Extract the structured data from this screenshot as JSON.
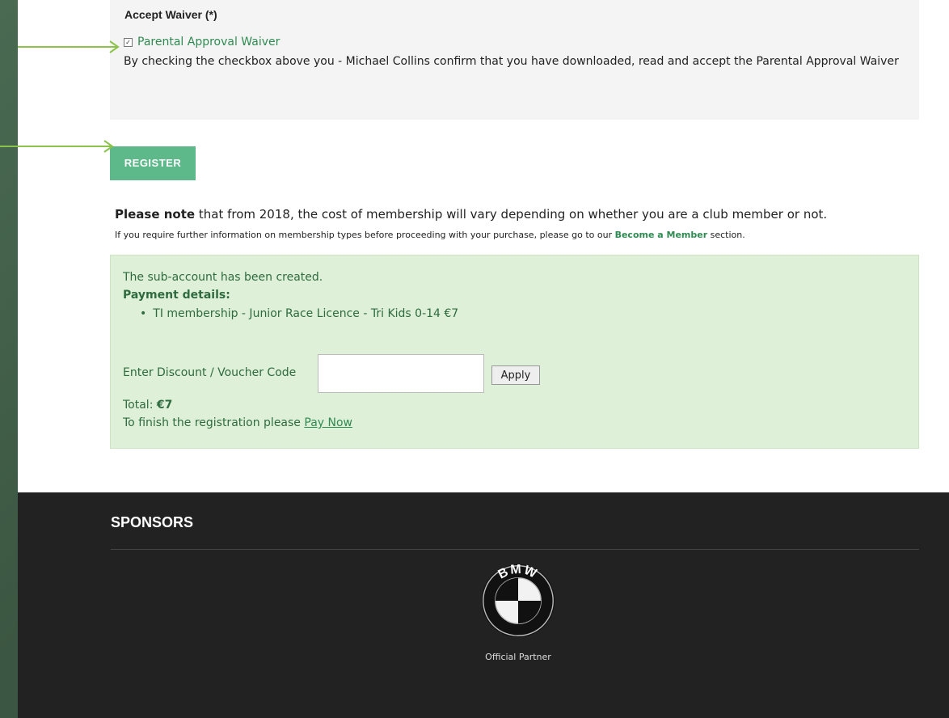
{
  "waiver": {
    "title": "Accept Waiver (*)",
    "checkbox_label": "Parental Approval Waiver",
    "checked": true,
    "description": "By checking the checkbox above you - Michael Collins confirm that you have downloaded, read and accept the Parental Approval Waiver"
  },
  "register": {
    "label": "REGISTER"
  },
  "note": {
    "bold": "Please note",
    "text": " that from 2018, the cost of membership will vary depending on whether you are a club member or not.",
    "small_prefix": "If you require further information on membership types before proceeding with your purchase, please go to our ",
    "small_link": "Become a Member",
    "small_suffix": " section."
  },
  "payment": {
    "created_msg": "The sub-account has been created.",
    "details_label": "Payment details:",
    "items": [
      "TI membership - Junior Race Licence - Tri Kids 0-14 €7"
    ],
    "discount_label": "Enter Discount / Voucher Code",
    "discount_value": "",
    "apply_label": "Apply",
    "total_label": "Total:",
    "total_value": "€7",
    "finish_prefix": "To finish the registration please ",
    "finish_link": "Pay Now"
  },
  "footer": {
    "sponsors_title": "SPONSORS",
    "sponsor_logo_text": "BMW",
    "partner_label": "Official Partner"
  },
  "colors": {
    "accent_green": "#2f8a52",
    "register_bg": "#5db88a",
    "success_bg": "#dff0d8",
    "footer_bg": "#222222",
    "arrow": "#8bc34a"
  }
}
